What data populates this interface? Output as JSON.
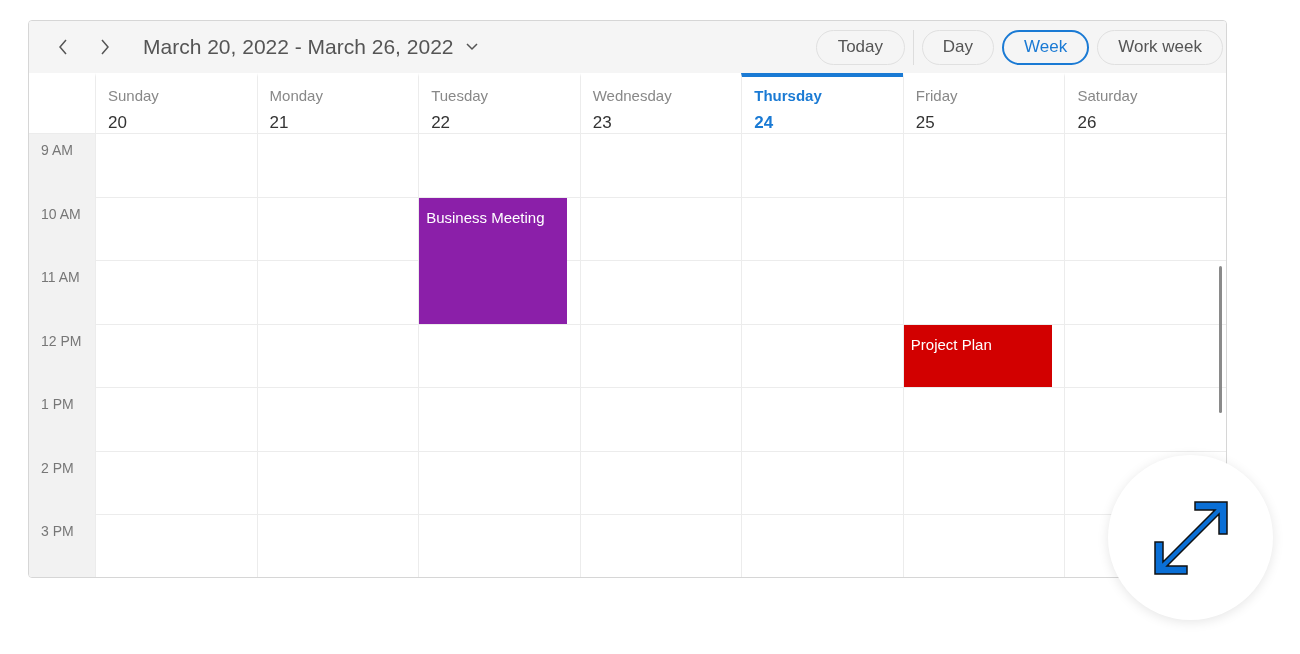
{
  "header": {
    "title": "March 20, 2022 - March 26, 2022",
    "today_button": "Today",
    "views": [
      {
        "label": "Day",
        "selected": false
      },
      {
        "label": "Week",
        "selected": true
      },
      {
        "label": "Work week",
        "selected": false
      }
    ]
  },
  "days": [
    {
      "name": "Sunday",
      "date": "20",
      "today": false
    },
    {
      "name": "Monday",
      "date": "21",
      "today": false
    },
    {
      "name": "Tuesday",
      "date": "22",
      "today": false
    },
    {
      "name": "Wednesday",
      "date": "23",
      "today": false
    },
    {
      "name": "Thursday",
      "date": "24",
      "today": true
    },
    {
      "name": "Friday",
      "date": "25",
      "today": false
    },
    {
      "name": "Saturday",
      "date": "26",
      "today": false
    }
  ],
  "time_slots": [
    {
      "label": "9 AM",
      "cells": [
        {
          "kind": "empty"
        },
        {
          "kind": "empty"
        },
        {
          "kind": "empty"
        },
        {
          "kind": "empty"
        },
        {
          "kind": "empty"
        },
        {
          "kind": "empty"
        },
        {
          "kind": "empty"
        }
      ]
    },
    {
      "label": "10 AM",
      "cells": [
        {
          "kind": "empty"
        },
        {
          "kind": "empty"
        },
        {
          "kind": "longevent",
          "title": "Business Meeting",
          "color": "#8b1fa9"
        },
        {
          "kind": "empty"
        },
        {
          "kind": "empty"
        },
        {
          "kind": "empty"
        },
        {
          "kind": "empty"
        }
      ]
    },
    {
      "label": "11 AM",
      "cells": [
        {
          "kind": "empty"
        },
        {
          "kind": "empty"
        },
        {
          "kind": "empty"
        },
        {
          "kind": "empty"
        },
        {
          "kind": "empty"
        },
        {
          "kind": "empty"
        },
        {
          "kind": "empty"
        }
      ]
    },
    {
      "label": "12 PM",
      "cells": [
        {
          "kind": "empty"
        },
        {
          "kind": "empty"
        },
        {
          "kind": "empty"
        },
        {
          "kind": "empty"
        },
        {
          "kind": "empty"
        },
        {
          "kind": "event",
          "title": "Project Plan",
          "color": "#d20000"
        },
        {
          "kind": "empty"
        }
      ]
    },
    {
      "label": "1 PM",
      "cells": [
        {
          "kind": "empty"
        },
        {
          "kind": "empty"
        },
        {
          "kind": "empty"
        },
        {
          "kind": "empty"
        },
        {
          "kind": "empty"
        },
        {
          "kind": "empty"
        },
        {
          "kind": "empty"
        }
      ]
    },
    {
      "label": "2 PM",
      "cells": [
        {
          "kind": "empty"
        },
        {
          "kind": "empty"
        },
        {
          "kind": "empty"
        },
        {
          "kind": "empty"
        },
        {
          "kind": "empty"
        },
        {
          "kind": "empty"
        },
        {
          "kind": "empty"
        }
      ]
    },
    {
      "label": "3 PM",
      "cells": [
        {
          "kind": "empty"
        },
        {
          "kind": "empty"
        },
        {
          "kind": "empty"
        },
        {
          "kind": "empty"
        },
        {
          "kind": "empty"
        },
        {
          "kind": "empty"
        },
        {
          "kind": "empty"
        }
      ]
    }
  ]
}
